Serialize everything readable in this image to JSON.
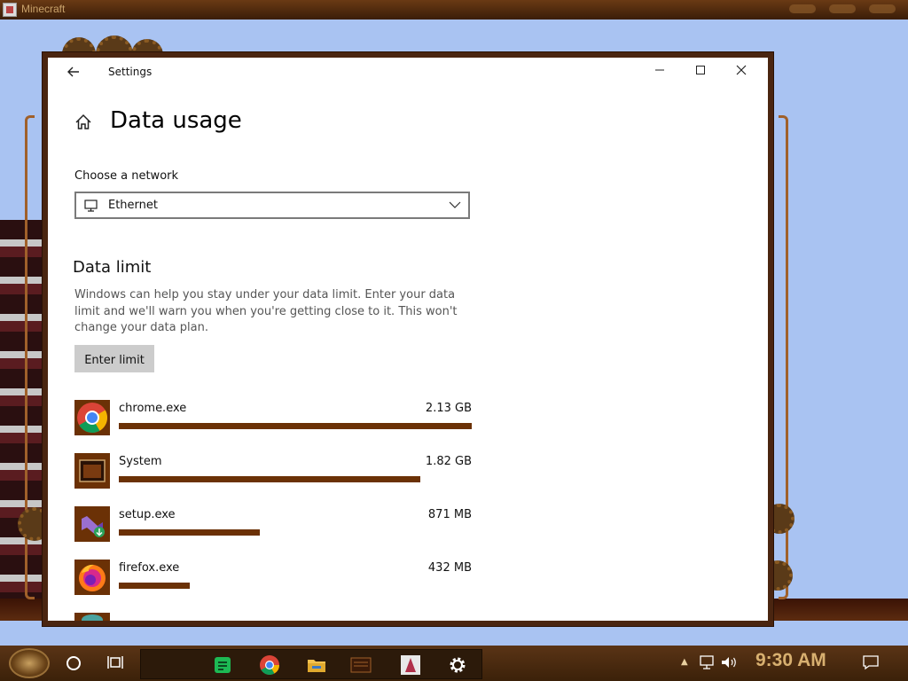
{
  "background_window": {
    "title": "Minecraft"
  },
  "settings": {
    "window_title": "Settings",
    "page_title": "Data usage",
    "network_label": "Choose a network",
    "network_value": "Ethernet",
    "data_limit_title": "Data limit",
    "data_limit_desc": "Windows can help you stay under your data limit. Enter your data limit and we'll warn you when you're getting close to it. This won't change your data plan.",
    "enter_limit": "Enter limit",
    "apps": [
      {
        "name": "chrome.exe",
        "size": "2.13 GB",
        "icon": "chrome-icon",
        "fraction": 1.0
      },
      {
        "name": "System",
        "size": "1.82 GB",
        "icon": "system-icon",
        "fraction": 0.854
      },
      {
        "name": "setup.exe",
        "size": "871 MB",
        "icon": "setup-icon",
        "fraction": 0.4
      },
      {
        "name": "firefox.exe",
        "size": "432 MB",
        "icon": "firefox-icon",
        "fraction": 0.2
      }
    ]
  },
  "taskbar": {
    "clock": "9:30 AM"
  },
  "colors": {
    "accent": "#6b3106",
    "window_bg": "#ffffff",
    "desktop": "#a9c3f2"
  }
}
